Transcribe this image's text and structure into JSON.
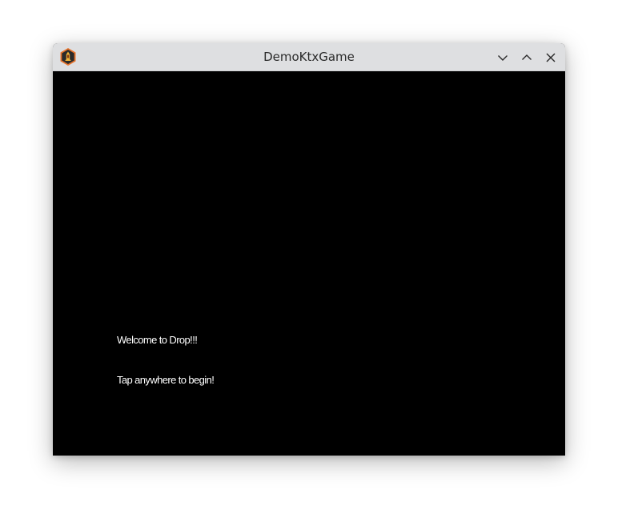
{
  "window": {
    "title": "DemoKtxGame",
    "app_icon": "game-app-icon",
    "controls": {
      "minimize_icon": "chevron-down-icon",
      "maximize_icon": "chevron-up-icon",
      "close_icon": "close-icon"
    }
  },
  "game": {
    "background_color": "#000000",
    "text_color": "#ffffff",
    "welcome_text": "Welcome to Drop!!!",
    "instruction_text": "Tap anywhere to begin!"
  }
}
